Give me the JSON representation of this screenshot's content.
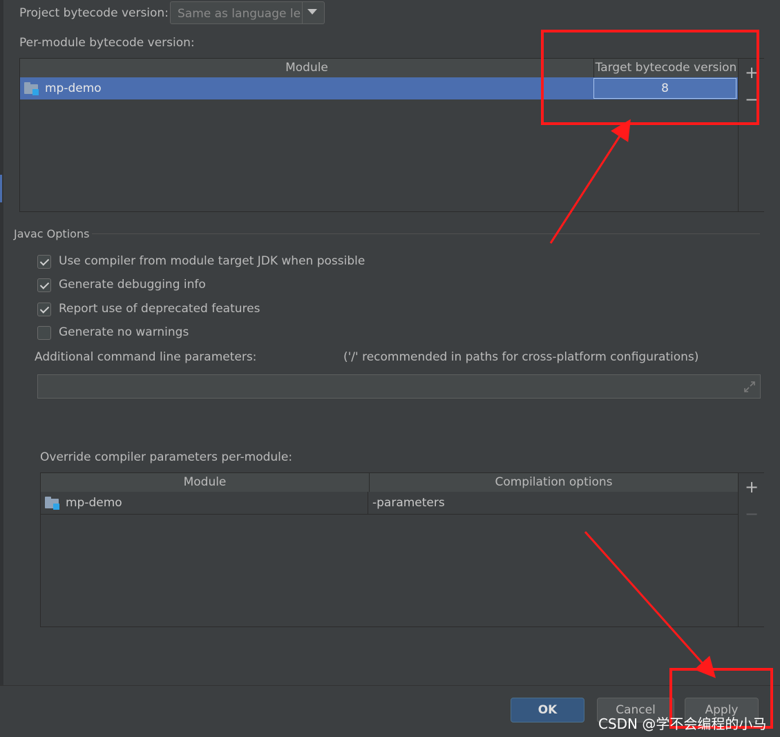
{
  "project_bytecode": {
    "label": "Project bytecode version:",
    "value": "Same as language le"
  },
  "per_module": {
    "label": "Per-module bytecode version:",
    "columns": [
      "Module",
      "Target bytecode version"
    ],
    "rows": [
      {
        "module": "mp-demo",
        "version": "8"
      }
    ],
    "add_label": "+",
    "remove_label": "−"
  },
  "javac": {
    "section_title": "Javac Options",
    "options": [
      {
        "label": "Use compiler from module target JDK when possible",
        "checked": true
      },
      {
        "label": "Generate debugging info",
        "checked": true
      },
      {
        "label": "Report use of deprecated features",
        "checked": true
      },
      {
        "label": "Generate no warnings",
        "checked": false
      }
    ],
    "additional_label": "Additional command line parameters:",
    "additional_hint": "('/' recommended in paths for cross-platform configurations)",
    "additional_value": ""
  },
  "override": {
    "label": "Override compiler parameters per-module:",
    "columns": [
      "Module",
      "Compilation options"
    ],
    "rows": [
      {
        "module": "mp-demo",
        "options": "-parameters"
      }
    ],
    "add_label": "+",
    "remove_label": "−"
  },
  "buttons": {
    "ok": "OK",
    "cancel": "Cancel",
    "apply": "Apply"
  },
  "watermark": "CSDN @学不会编程的小马",
  "colors": {
    "annotation": "#ff1a1a",
    "selection": "#4b6eaf",
    "background": "#3c3f41"
  }
}
